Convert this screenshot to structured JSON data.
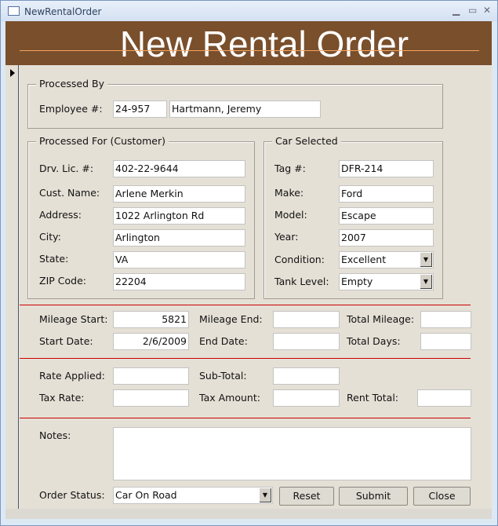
{
  "window": {
    "title": "NewRentalOrder"
  },
  "header": {
    "title": "New Rental Order"
  },
  "processed_by": {
    "legend": "Processed By",
    "employee_label": "Employee #:",
    "employee_number": "24-957",
    "employee_name": "Hartmann, Jeremy"
  },
  "customer": {
    "legend": "Processed For (Customer)",
    "dl_label": "Drv. Lic. #:",
    "dl": "402-22-9644",
    "name_label": "Cust. Name:",
    "name": "Arlene Merkin",
    "address_label": "Address:",
    "address": "1022 Arlington Rd",
    "city_label": "City:",
    "city": "Arlington",
    "state_label": "State:",
    "state": "VA",
    "zip_label": "ZIP Code:",
    "zip": "22204"
  },
  "car": {
    "legend": "Car Selected",
    "tag_label": "Tag #:",
    "tag": "DFR-214",
    "make_label": "Make:",
    "make": "Ford",
    "model_label": "Model:",
    "model": "Escape",
    "year_label": "Year:",
    "year": "2007",
    "condition_label": "Condition:",
    "condition": "Excellent",
    "tank_label": "Tank Level:",
    "tank": "Empty"
  },
  "mileage": {
    "start_label": "Mileage Start:",
    "start": "5821",
    "end_label": "Mileage End:",
    "end": "",
    "total_label": "Total Mileage:",
    "total": ""
  },
  "dates": {
    "start_label": "Start Date:",
    "start": "2/6/2009",
    "end_label": "End Date:",
    "end": "",
    "days_label": "Total Days:",
    "days": ""
  },
  "billing": {
    "rate_label": "Rate Applied:",
    "rate": "",
    "subtotal_label": "Sub-Total:",
    "subtotal": "",
    "taxrate_label": "Tax Rate:",
    "taxrate": "",
    "taxamount_label": "Tax Amount:",
    "taxamount": "",
    "renttotal_label": "Rent Total:",
    "renttotal": ""
  },
  "notes": {
    "label": "Notes:",
    "value": ""
  },
  "order_status": {
    "label": "Order Status:",
    "value": "Car On Road"
  },
  "buttons": {
    "reset": "Reset",
    "submit": "Submit",
    "close": "Close"
  },
  "colors": {
    "header": "#7a4f2c",
    "accent_line": "#f5a45f",
    "divider": "#cc0000",
    "form_bg": "#e5e0d6"
  }
}
